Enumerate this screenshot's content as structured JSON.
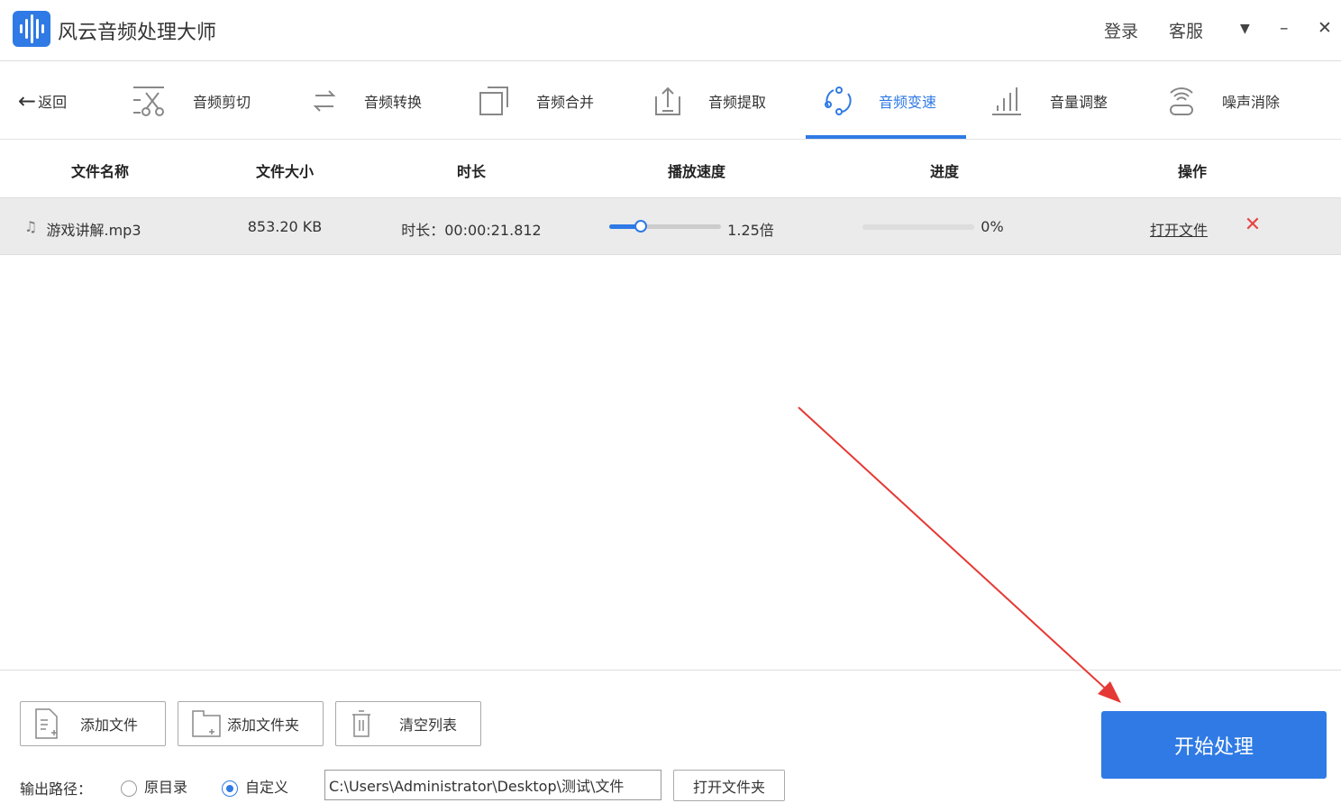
{
  "app": {
    "title": "风云音频处理大师",
    "login": "登录",
    "service": "客服"
  },
  "nav": {
    "back": "返回",
    "items": [
      {
        "label": "音频剪切",
        "icon": "scissors-icon"
      },
      {
        "label": "音频转换",
        "icon": "convert-icon"
      },
      {
        "label": "音频合并",
        "icon": "merge-icon"
      },
      {
        "label": "音频提取",
        "icon": "extract-icon"
      },
      {
        "label": "音频变速",
        "icon": "speed-icon",
        "active": true
      },
      {
        "label": "音量调整",
        "icon": "volume-icon"
      },
      {
        "label": "噪声消除",
        "icon": "noise-icon"
      }
    ]
  },
  "table": {
    "headers": [
      "文件名称",
      "文件大小",
      "时长",
      "播放速度",
      "进度",
      "操作"
    ],
    "rows": [
      {
        "name": "游戏讲解.mp3",
        "size": "853.20 KB",
        "duration": "时长：00:00:21.812",
        "speed": "1.25倍",
        "speed_fraction": 0.28,
        "progress": "0%",
        "progress_fraction": 0,
        "open": "打开文件"
      }
    ]
  },
  "footer": {
    "add_file": "添加文件",
    "add_folder": "添加文件夹",
    "clear": "清空列表",
    "output_label": "输出路径：",
    "opt_original": "原目录",
    "opt_custom": "自定义",
    "path": "C:\\Users\\Administrator\\Desktop\\测试\\文件",
    "open_folder": "打开文件夹",
    "start": "开始处理"
  },
  "colors": {
    "accent": "#2f7ae5",
    "delete": "#e64545",
    "annotation": "#e53935"
  }
}
